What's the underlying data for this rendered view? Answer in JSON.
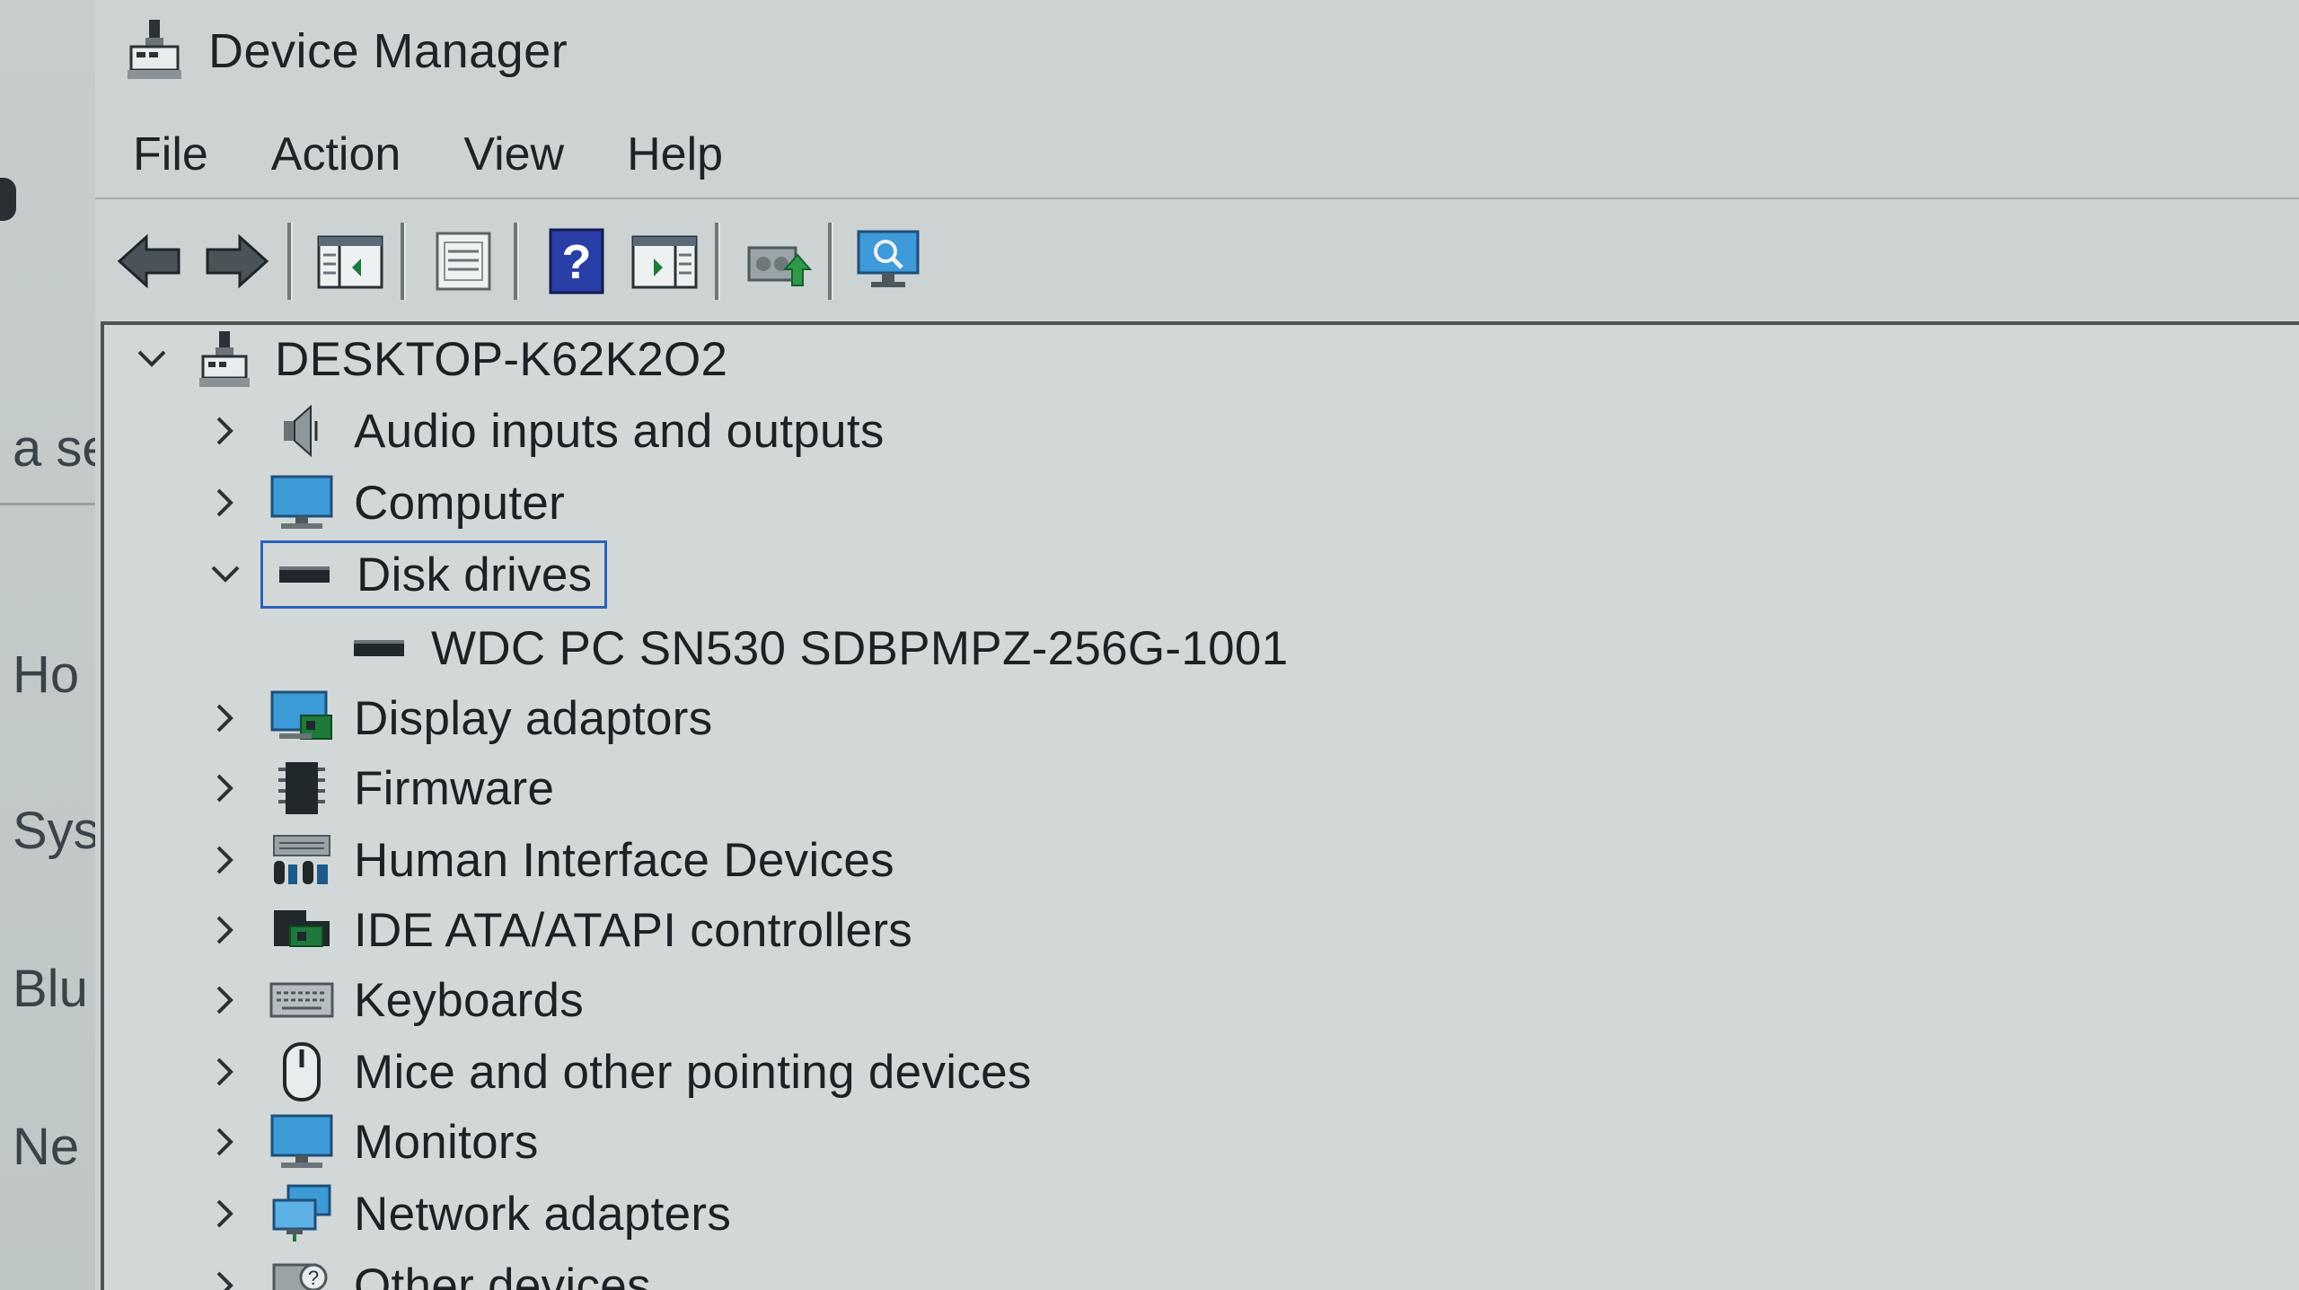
{
  "window": {
    "title": "Device Manager"
  },
  "background_window": {
    "peek_texts": [
      "a se",
      "Ho",
      "Sys",
      "Blu",
      "Ne"
    ]
  },
  "menu": {
    "items": [
      "File",
      "Action",
      "View",
      "Help"
    ]
  },
  "toolbar": {
    "buttons": [
      {
        "icon": "back-arrow-icon"
      },
      {
        "icon": "forward-arrow-icon"
      },
      {
        "icon": "show-hide-console-tree-icon"
      },
      {
        "icon": "properties-icon"
      },
      {
        "icon": "help-icon"
      },
      {
        "icon": "show-action-pane-icon"
      },
      {
        "icon": "update-driver-icon"
      },
      {
        "icon": "scan-hardware-changes-icon"
      }
    ]
  },
  "tree": {
    "root": {
      "label": "DESKTOP-K62K2O2",
      "expanded": true
    },
    "categories": [
      {
        "label": "Audio inputs and outputs",
        "icon": "speaker-icon",
        "expanded": false
      },
      {
        "label": "Computer",
        "icon": "computer-icon",
        "expanded": false
      },
      {
        "label": "Disk drives",
        "icon": "disk-drive-icon",
        "expanded": true,
        "selected": true,
        "children": [
          {
            "label": "WDC PC SN530 SDBPMPZ-256G-1001",
            "icon": "disk-drive-icon"
          }
        ]
      },
      {
        "label": "Display adaptors",
        "icon": "display-adapter-icon",
        "expanded": false
      },
      {
        "label": "Firmware",
        "icon": "firmware-chip-icon",
        "expanded": false
      },
      {
        "label": "Human Interface Devices",
        "icon": "hid-icon",
        "expanded": false
      },
      {
        "label": "IDE ATA/ATAPI controllers",
        "icon": "ide-controller-icon",
        "expanded": false
      },
      {
        "label": "Keyboards",
        "icon": "keyboard-icon",
        "expanded": false
      },
      {
        "label": "Mice and other pointing devices",
        "icon": "mouse-icon",
        "expanded": false
      },
      {
        "label": "Monitors",
        "icon": "monitor-icon",
        "expanded": false
      },
      {
        "label": "Network adapters",
        "icon": "network-adapter-icon",
        "expanded": false
      },
      {
        "label": "Other devices",
        "icon": "other-devices-icon",
        "expanded": false
      }
    ]
  },
  "colors": {
    "selection_border": "#2a62b8",
    "window_background": "#cdd3d2",
    "text": "#1a2226"
  }
}
